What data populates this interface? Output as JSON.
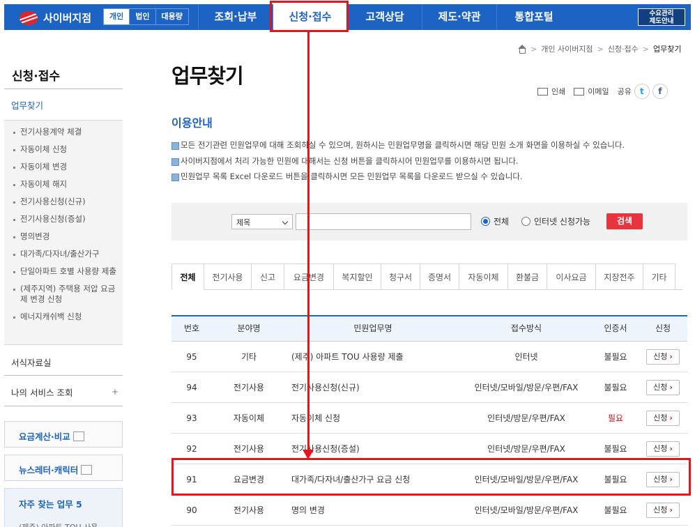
{
  "header": {
    "logo": "사이버지점",
    "segments": [
      {
        "label": "개인",
        "active": true
      },
      {
        "label": "법인",
        "active": false
      },
      {
        "label": "대용량",
        "active": false
      }
    ],
    "menu": [
      {
        "label": "조회·납부",
        "active": false
      },
      {
        "label": "신청·접수",
        "active": true
      },
      {
        "label": "고객상담",
        "active": false
      },
      {
        "label": "제도·약관",
        "active": false
      },
      {
        "label": "통합포털",
        "active": false
      }
    ],
    "side_button": [
      "수요관리",
      "제도안내"
    ]
  },
  "sidebar": {
    "title": "신청·접수",
    "selected": "업무찾기",
    "items": [
      "전기사용계약 체결",
      "자동이체 신청",
      "자동이체 변경",
      "자동이체 해지",
      "전기사용신청(신규)",
      "전기사용신청(증설)",
      "명의변경",
      "대가족/다자녀/출산가구",
      "단일아파트 호별 사용량 제출",
      "(제주지역) 주택용 저압 요금제 변경 신청",
      "에너지캐쉬백 신청"
    ],
    "forms": "서식자료실",
    "my_service": "나의 서비스 조회",
    "plus": "+",
    "box1": "요금계산·비교",
    "box2": "뉴스레터·캐릭터",
    "fav_title": "자주 찾는 업무 5",
    "fav_item": "(제주) 아파트 TOU 사용"
  },
  "breadcrumb": {
    "items": [
      "개인 사이버지점",
      "신청·접수"
    ],
    "current": "업무찾기"
  },
  "page_title": "업무찾기",
  "tools": {
    "print": "인쇄",
    "email": "이메일",
    "share": "공유",
    "twitter": "t",
    "facebook": "f"
  },
  "section_title": "이용안내",
  "guide": [
    "모든 전기관련 민원업무에 대해 조회하실 수 있으며, 원하시는 민원업무명을 클릭하시면 해당 민원 소개 화면을 이용하실 수 있습니다.",
    "사이버지점에서 처리 가능한 민원에 대해서는 신청 버튼을 클릭하시어 민원업무를 이용하시면 됩니다.",
    "민원업무 목록 Excel 다운로드 버튼을 클릭하시면 모든 민원업무 목록을 다운로드 받으실 수 있습니다."
  ],
  "search": {
    "select": "제목",
    "input_value": "",
    "radio_all": "전체",
    "radio_online": "인터넷 신청가능",
    "button": "검색"
  },
  "tabs": [
    {
      "label": "전체",
      "active": true
    },
    {
      "label": "전기사용",
      "active": false
    },
    {
      "label": "신고",
      "active": false
    },
    {
      "label": "요금변경",
      "active": false
    },
    {
      "label": "복지할인",
      "active": false
    },
    {
      "label": "청구서",
      "active": false
    },
    {
      "label": "증명서",
      "active": false
    },
    {
      "label": "자동이체",
      "active": false
    },
    {
      "label": "환불금",
      "active": false
    },
    {
      "label": "이사요금",
      "active": false
    },
    {
      "label": "지장전주",
      "active": false
    },
    {
      "label": "기타",
      "active": false
    }
  ],
  "table": {
    "headers": [
      "번호",
      "분야명",
      "민원업무명",
      "접수방식",
      "인증서",
      "신청"
    ],
    "apply_label": "신청",
    "rows": [
      {
        "no": "95",
        "field": "기타",
        "name": "(제주) 아파트 TOU 사용량 제출",
        "method": "인터넷",
        "cert": "불필요",
        "required": false
      },
      {
        "no": "94",
        "field": "전기사용",
        "name": "전기사용신청(신규)",
        "method": "인터넷/모바일/방문/우편/FAX",
        "cert": "불필요",
        "required": false
      },
      {
        "no": "93",
        "field": "자동이체",
        "name": "자동이체 신청",
        "method": "인터넷/방문/우편/FAX",
        "cert": "필요",
        "required": true
      },
      {
        "no": "92",
        "field": "전기사용",
        "name": "전기사용신청(증설)",
        "method": "인터넷/방문/우편/FAX",
        "cert": "불필요",
        "required": false
      },
      {
        "no": "91",
        "field": "요금변경",
        "name": "대가족/다자녀/출산가구 요금 신청",
        "method": "인터넷/모바일/방문/우편/FAX",
        "cert": "불필요",
        "required": false
      },
      {
        "no": "90",
        "field": "전기사용",
        "name": "명의 변경",
        "method": "인터넷/모바일/방문/우편/FAX",
        "cert": "불필요",
        "required": false
      }
    ]
  },
  "colors": {
    "brand": "#1c63c4",
    "highlight": "#e8141c",
    "search_button": "#e8353d"
  }
}
